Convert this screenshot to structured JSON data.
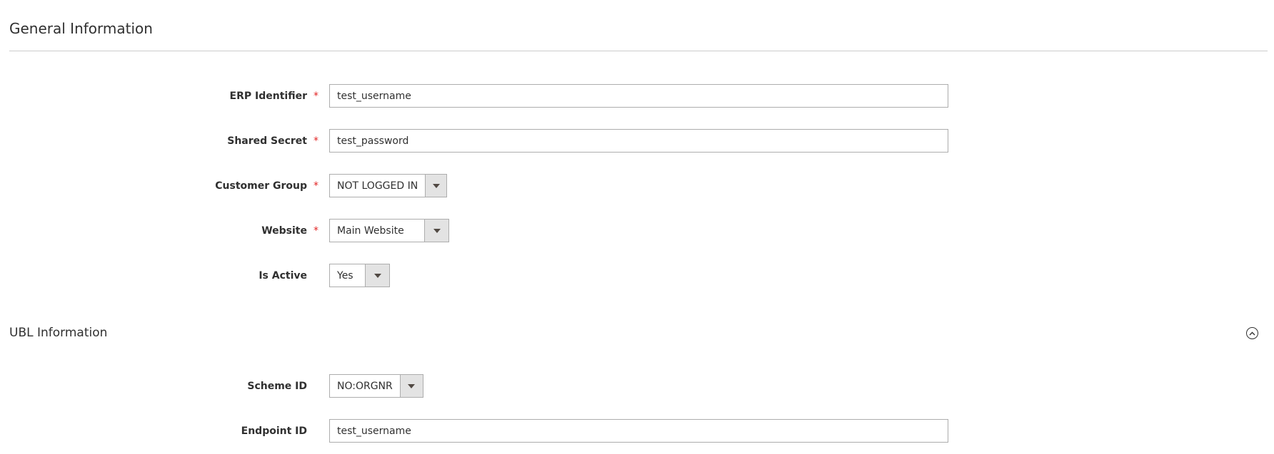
{
  "general": {
    "title": "General Information"
  },
  "fields": {
    "erp_identifier": {
      "label": "ERP Identifier",
      "required": "*",
      "value": "test_username"
    },
    "shared_secret": {
      "label": "Shared Secret",
      "required": "*",
      "value": "test_password"
    },
    "customer_group": {
      "label": "Customer Group",
      "required": "*",
      "value": "NOT LOGGED IN"
    },
    "website": {
      "label": "Website",
      "required": "*",
      "value": "Main Website"
    },
    "is_active": {
      "label": "Is Active",
      "value": "Yes"
    }
  },
  "ubl": {
    "title": "UBL Information",
    "collapse_icon": "chevron-up-circle-icon",
    "scheme_id": {
      "label": "Scheme ID",
      "value": "NO:ORGNR"
    },
    "endpoint_id": {
      "label": "Endpoint ID",
      "value": "test_username"
    }
  },
  "colors": {
    "required": "#e22626",
    "border": "#adadad",
    "select_button": "#e3e3e3",
    "divider": "#cccccc"
  }
}
